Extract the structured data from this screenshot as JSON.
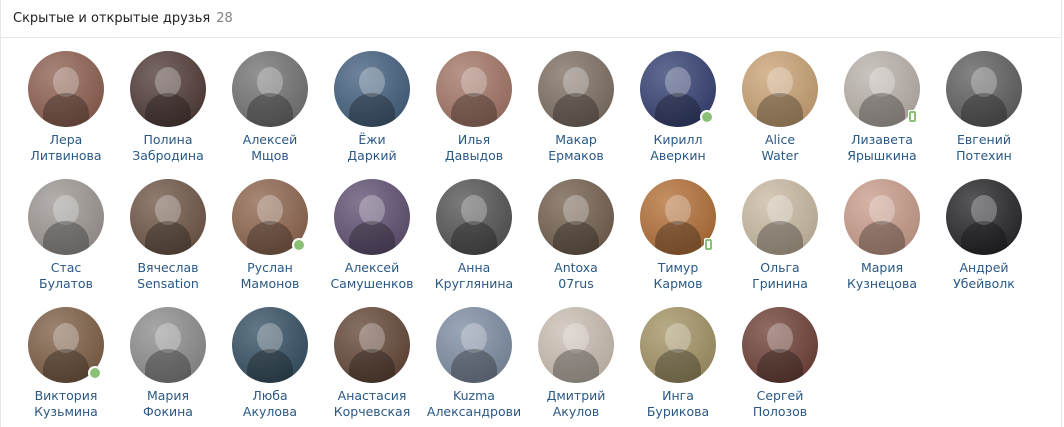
{
  "header": {
    "title": "Скрытые и открытые друзья",
    "count": "28"
  },
  "friends": [
    {
      "first": "Лера",
      "last": "Литвинова",
      "color": "#8a5a4a",
      "online": ""
    },
    {
      "first": "Полина",
      "last": "Забродина",
      "color": "#4a3430",
      "online": ""
    },
    {
      "first": "Алексей",
      "last": "Мщов",
      "color": "#6e6e6e",
      "online": ""
    },
    {
      "first": "Ёжи",
      "last": "Даркий",
      "color": "#3d5a7a",
      "online": ""
    },
    {
      "first": "Илья",
      "last": "Давыдов",
      "color": "#a07060",
      "online": ""
    },
    {
      "first": "Макар",
      "last": "Ермаков",
      "color": "#7a6a5e",
      "online": ""
    },
    {
      "first": "Кирилл",
      "last": "Аверкин",
      "color": "#2d3a6e",
      "online": "dot"
    },
    {
      "first": "Alice",
      "last": "Water",
      "color": "#c9a070",
      "online": ""
    },
    {
      "first": "Лизавета",
      "last": "Ярышкина",
      "color": "#b8b0a8",
      "online": "mobile"
    },
    {
      "first": "Евгений",
      "last": "Потехин",
      "color": "#5a5a5a",
      "online": ""
    },
    {
      "first": "Стас",
      "last": "Булатов",
      "color": "#9a9490",
      "online": ""
    },
    {
      "first": "Вячеслав",
      "last": "Sensation",
      "color": "#6a5040",
      "online": ""
    },
    {
      "first": "Руслан",
      "last": "Мамонов",
      "color": "#8a6048",
      "online": "dot"
    },
    {
      "first": "Алексей",
      "last": "Самушенков",
      "color": "#5a4a6e",
      "online": ""
    },
    {
      "first": "Анна",
      "last": "Круглянина",
      "color": "#4e4e4e",
      "online": ""
    },
    {
      "first": "Antoxa",
      "last": "07rus",
      "color": "#6e5a48",
      "online": ""
    },
    {
      "first": "Тимур",
      "last": "Кармов",
      "color": "#b06a30",
      "online": "mobile"
    },
    {
      "first": "Ольга",
      "last": "Гринина",
      "color": "#c8b8a0",
      "online": ""
    },
    {
      "first": "Мария",
      "last": "Кузнецова",
      "color": "#c89a88",
      "online": ""
    },
    {
      "first": "Андрей",
      "last": "Убейволк",
      "color": "#1e1e22",
      "online": ""
    },
    {
      "first": "Виктория",
      "last": "Кузьмина",
      "color": "#7a5a40",
      "online": "dot"
    },
    {
      "first": "Мария",
      "last": "Фокина",
      "color": "#8a8a8a",
      "online": ""
    },
    {
      "first": "Люба",
      "last": "Акулова",
      "color": "#2e4a5e",
      "online": ""
    },
    {
      "first": "Анастасия",
      "last": "Корчевская",
      "color": "#5e4030",
      "online": ""
    },
    {
      "first": "Kuzma",
      "last": "Александрови",
      "color": "#7a8aa0",
      "online": ""
    },
    {
      "first": "Дмитрий",
      "last": "Акулов",
      "color": "#c8bcb0",
      "online": ""
    },
    {
      "first": "Инга",
      "last": "Бурикова",
      "color": "#a09060",
      "online": ""
    },
    {
      "first": "Сергей",
      "last": "Полозов",
      "color": "#6a3a30",
      "online": ""
    }
  ]
}
